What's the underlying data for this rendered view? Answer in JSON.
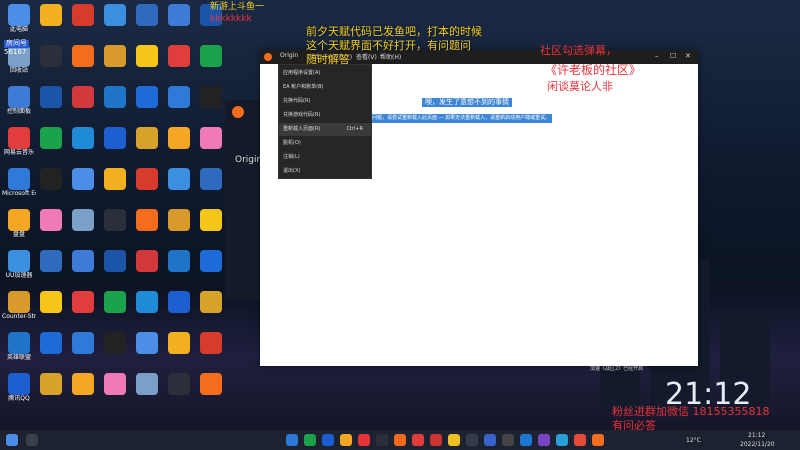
{
  "overlay": {
    "top_left_1": "新游上斗鱼一",
    "top_left_2": "kkkkkkkk",
    "stream_id_label": "房间号",
    "stream_id": "56167",
    "notice_1": "前夕天赋代码已发鱼吧，打本的时候",
    "notice_2": "这个天赋界面不好打开，有问题问",
    "notice_3": "随时解答",
    "community_1": "社区勾选弹幕，",
    "community_2": "《许老板的社区》",
    "community_3": "闲谈莫论人非",
    "bottom_right_1": "粉丝进群加微信 18155355818",
    "bottom_right_2": "有问必答"
  },
  "app": {
    "origin_left": "Origin",
    "menus": [
      "Origin",
      "游戏(G)",
      "好友(F)",
      "查看(V)",
      "帮助(H)"
    ],
    "dropdown": [
      {
        "label": "应用程序设置(A)",
        "shortcut": ""
      },
      {
        "label": "EA 帐户和账单(B)",
        "shortcut": ""
      },
      {
        "label": "兑换代码(R)",
        "shortcut": ""
      },
      {
        "label": "兑换游戏代码(R)",
        "shortcut": ""
      },
      {
        "label": "重新载入页面(R)",
        "shortcut": "Ctrl+R"
      },
      {
        "label": "脱机(O)",
        "shortcut": ""
      },
      {
        "label": "注销(L)",
        "shortcut": ""
      },
      {
        "label": "退出(X)",
        "shortcut": ""
      }
    ],
    "selection_line_1": "噢，发生了意想不到的事情",
    "selection_line_2": "发生问题，请尝试重新载入此页面 — 如果无法重新载入，请重新启动用户端或重试。",
    "status_right": "加速《战区2》已经开启"
  },
  "stream_panel": {
    "origin_label": "Origin"
  },
  "desktop_icons": [
    "此电脑",
    "回收站",
    "控制面板",
    "网易云音乐",
    "Microsoft Edge",
    "盘盘",
    "UU加速器",
    "Counter-Strike",
    "英雄联盟",
    "腾讯QQ",
    "雷电模拟器",
    "Steam",
    "暴雪战网",
    "微信",
    "Epic Games",
    "PICO PARK",
    "Wallpaper Engine",
    "WeGame",
    "Battle.net",
    "PUBG",
    "Rockstar",
    "Origin",
    "网易有道",
    "酷狗音乐"
  ],
  "clock": {
    "time": "21:12",
    "date_tray": "2022/11/20",
    "time_tray": "21:12",
    "temp": "12°C"
  },
  "colors": {
    "accent": "#f56c1d",
    "highlight": "#3d86d6",
    "notice_yellow": "#f5d020",
    "community_red": "#e8323a"
  }
}
